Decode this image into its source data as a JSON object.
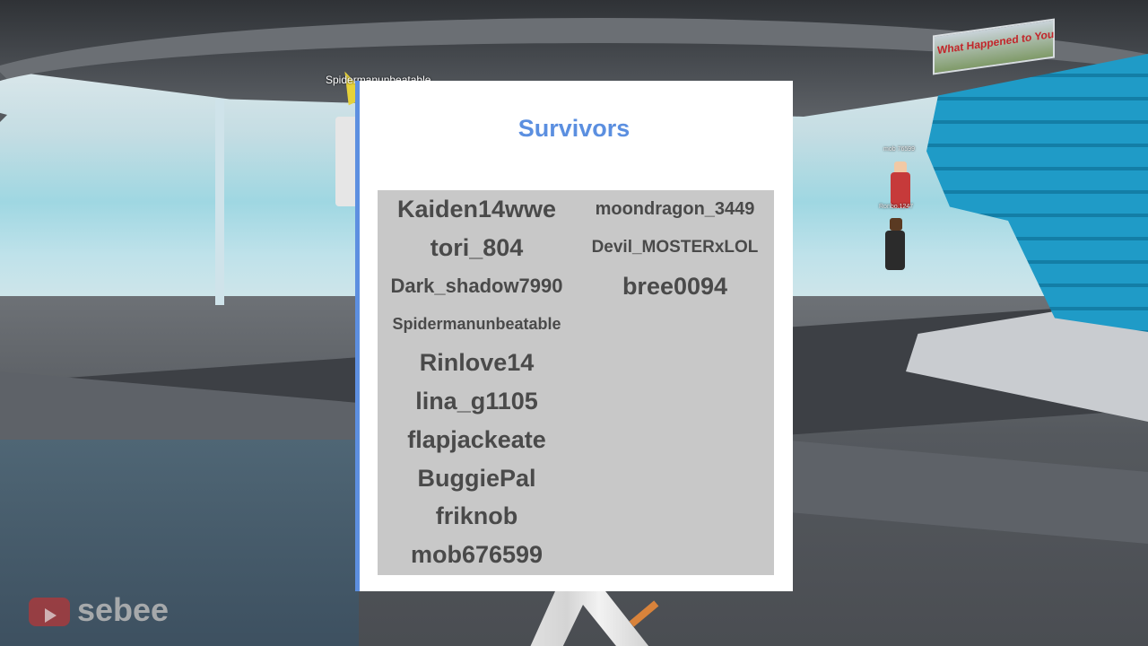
{
  "panel": {
    "title": "Survivors",
    "left_column": [
      "Kaiden14wwe",
      "tori_804",
      "Dark_shadow7990",
      "Spidermanunbeatable",
      "Rinlove14",
      "lina_g1105",
      "flapjackeate",
      "BuggiePal",
      "friknob",
      "mob676599"
    ],
    "right_column": [
      "moondragon_3449",
      "Devil_MOSTERxLOL",
      "bree0094"
    ]
  },
  "world": {
    "player_name_tag": "Spidermanunbeatable",
    "sign_text": "What Happened to You",
    "npc_tag_1": "mob 76599",
    "npc_tag_2": "Ronbo.1247"
  },
  "watermark": {
    "channel_name": "sebee",
    "icon": "youtube-play-icon"
  },
  "colors": {
    "title": "#5b8fe0",
    "panel_accent": "#5d8fe0",
    "grid_background": "#c8c8c8",
    "name_text": "#4a4a4a",
    "stairs": "#1f9bc7"
  }
}
